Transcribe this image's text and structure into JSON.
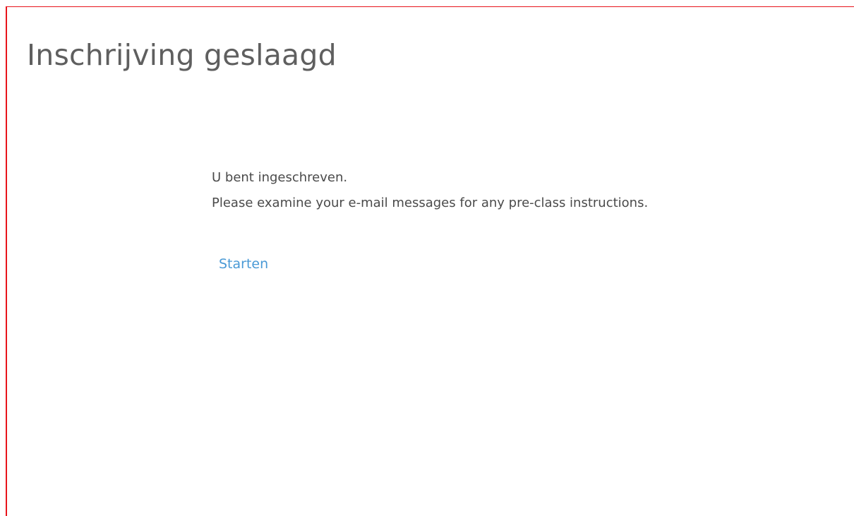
{
  "page": {
    "title": "Inschrijving geslaagd"
  },
  "message": {
    "line1": "U bent ingeschreven.",
    "line2": "Please examine your e-mail messages for any pre-class instructions."
  },
  "actions": {
    "start_label": "Starten"
  },
  "colors": {
    "frame_border": "#e8141b",
    "title_text": "#5f5f5f",
    "body_text": "#4a4a4a",
    "link": "#4a9ad6"
  }
}
